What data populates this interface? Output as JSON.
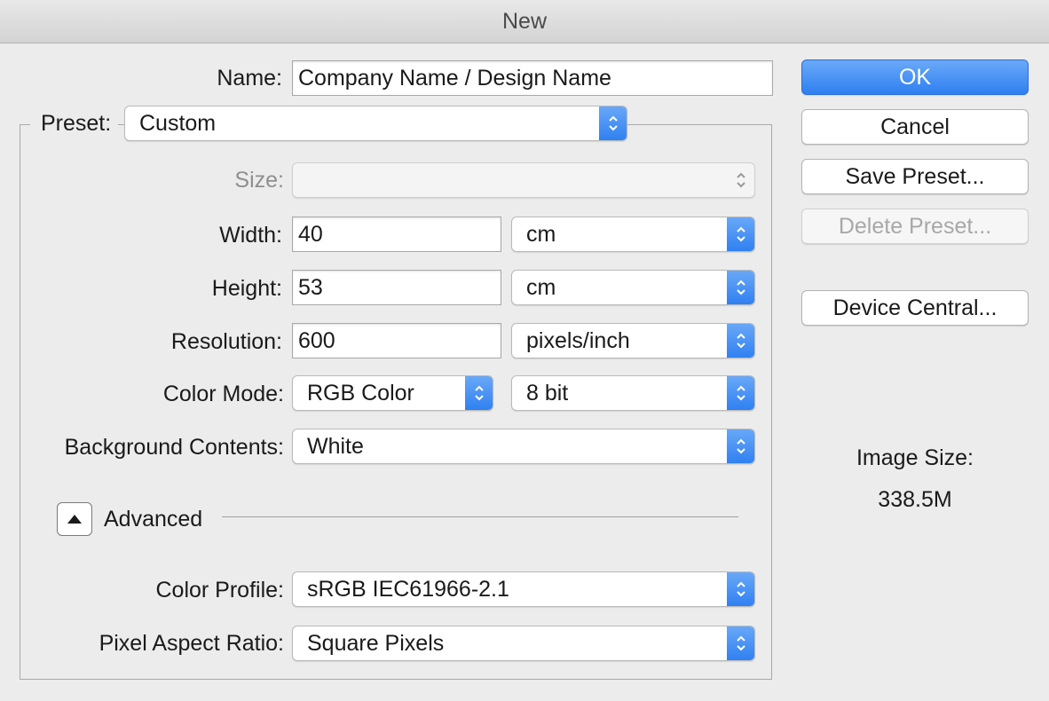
{
  "window": {
    "title": "New"
  },
  "name": {
    "label": "Name:",
    "value": "Company Name / Design Name"
  },
  "preset": {
    "label": "Preset:",
    "value": "Custom"
  },
  "size": {
    "label": "Size:",
    "value": ""
  },
  "width": {
    "label": "Width:",
    "value": "40",
    "unit": "cm"
  },
  "height": {
    "label": "Height:",
    "value": "53",
    "unit": "cm"
  },
  "resolution": {
    "label": "Resolution:",
    "value": "600",
    "unit": "pixels/inch"
  },
  "color_mode": {
    "label": "Color Mode:",
    "value": "RGB Color",
    "depth": "8 bit"
  },
  "background": {
    "label": "Background Contents:",
    "value": "White"
  },
  "advanced": {
    "label": "Advanced"
  },
  "color_profile": {
    "label": "Color Profile:",
    "value": "sRGB IEC61966-2.1"
  },
  "pixel_aspect": {
    "label": "Pixel Aspect Ratio:",
    "value": "Square Pixels"
  },
  "buttons": {
    "ok": "OK",
    "cancel": "Cancel",
    "save_preset": "Save Preset...",
    "delete_preset": "Delete Preset...",
    "device_central": "Device Central..."
  },
  "image_size": {
    "label": "Image Size:",
    "value": "338.5M"
  },
  "colors": {
    "accent": "#2f7ff1",
    "window_bg": "#ececec"
  },
  "icons": {
    "stepper": "up-down-chevron-icon",
    "disclosure": "triangle-up-icon"
  }
}
